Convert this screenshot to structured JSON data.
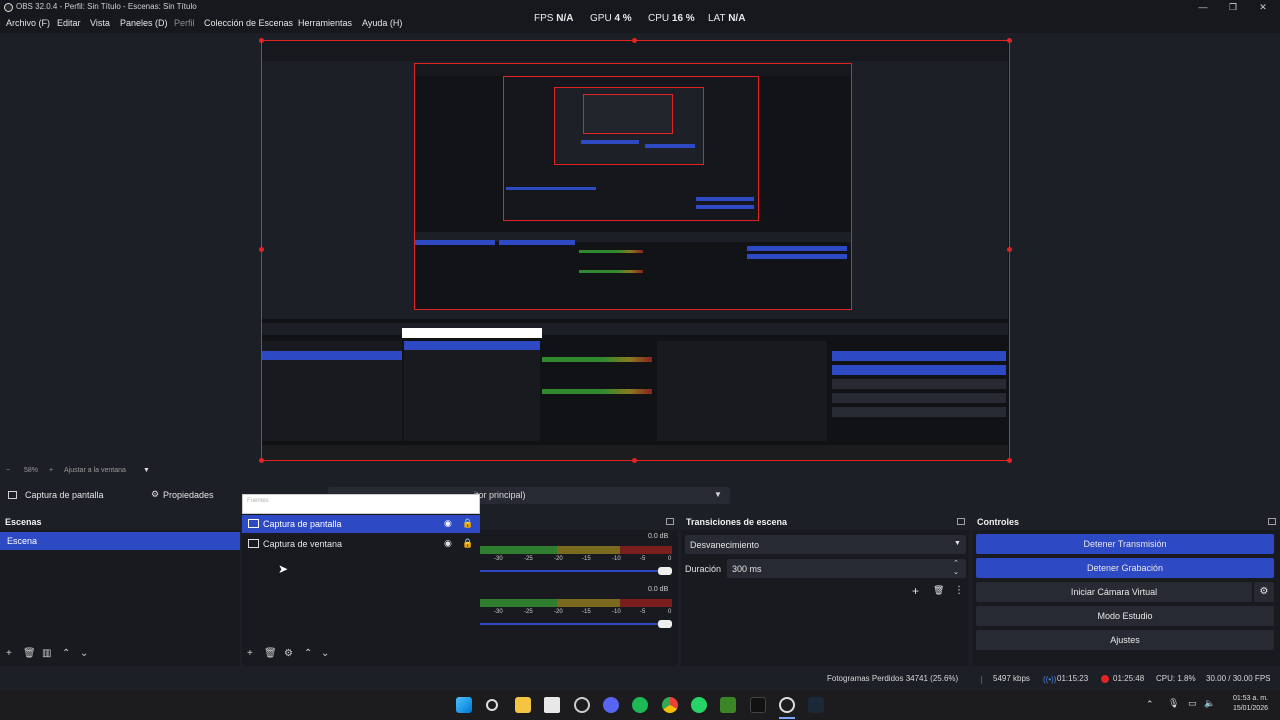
{
  "window": {
    "title": "OBS 32.0.4 - Perfil: Sin Título - Escenas: Sin Título",
    "minimize": "—",
    "maximize": "❐",
    "close": "✕"
  },
  "menu": {
    "items": [
      "Archivo (F)",
      "Editar",
      "Vista",
      "Paneles (D)",
      "Perfil",
      "Colección de Escenas",
      "Herramientas",
      "Ayuda (H)"
    ]
  },
  "stats": {
    "fps_label": "FPS",
    "fps_value": "N/A",
    "gpu_label": "GPU",
    "gpu_value": "4 %",
    "cpu_label": "CPU",
    "cpu_value": "16 %",
    "lat_label": "LAT",
    "lat_value": "N/A"
  },
  "zoom": {
    "minus": "−",
    "value": "58%",
    "plus": "+",
    "fit_label": "Ajustar a la ventana",
    "dropdown": "▼"
  },
  "source_toolbar": {
    "source_name": "Captura de pantalla",
    "properties_label": "Propiedades",
    "monitor_text": "itor principal)"
  },
  "fuentes_popup": {
    "label": "Fuentes"
  },
  "scenes": {
    "title": "Escenas",
    "items": [
      "Escena"
    ]
  },
  "sources": {
    "items": [
      {
        "name": "Captura de pantalla",
        "selected": true
      },
      {
        "name": "Captura de ventana",
        "selected": false
      }
    ]
  },
  "audio": {
    "db_1": "0.0 dB",
    "db_2": "0.0 dB",
    "ticks": [
      "-30",
      "-25",
      "-20",
      "-15",
      "-10",
      "-5",
      "0"
    ]
  },
  "transitions": {
    "title": "Transiciones de escena",
    "selected": "Desvanecimiento",
    "duration_label": "Duración",
    "duration_value": "300 ms"
  },
  "controls": {
    "title": "Controles",
    "buttons": [
      {
        "label": "Detener Transmisión",
        "active": true
      },
      {
        "label": "Detener Grabación",
        "active": true
      },
      {
        "label": "Iniciar Cámara Virtual",
        "active": false
      },
      {
        "label": "Modo Estudio",
        "active": false
      },
      {
        "label": "Ajustes",
        "active": false
      }
    ]
  },
  "status": {
    "frames": "Fotogramas Perdidos 34741 (25.6%)",
    "bitrate": "5497 kbps",
    "stream_time": "01:15:23",
    "rec_time": "01:25:48",
    "cpu": "CPU: 1.8%",
    "fps": "30.00 / 30.00 FPS"
  },
  "taskbar": {
    "time": "01:53 a. m.",
    "date": "15/01/2026"
  },
  "colors": {
    "accent": "#2e49c4",
    "selection_border": "#e02424",
    "background": "#1d1f26"
  }
}
